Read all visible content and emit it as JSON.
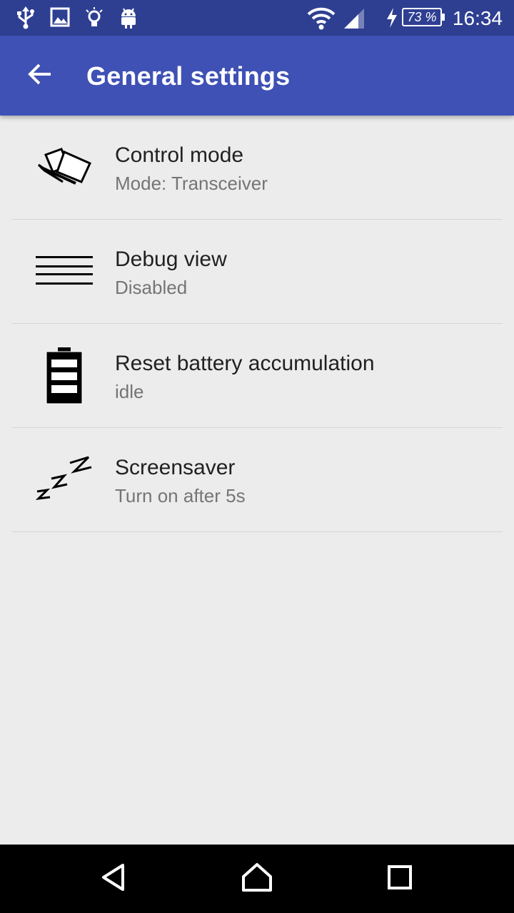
{
  "status_bar": {
    "icons": [
      "usb-icon",
      "image-icon",
      "lightbulb-icon",
      "android-icon",
      "wifi-icon",
      "signal-icon",
      "charging-icon"
    ],
    "battery_text": "73 %",
    "time": "16:34"
  },
  "app_bar": {
    "back_icon": "arrow-left-icon",
    "title": "General settings",
    "background": "#3f51b5",
    "status_background": "#2e3f92"
  },
  "settings": [
    {
      "icon": "control-mode-icon",
      "title": "Control mode",
      "summary": "Mode: Transceiver"
    },
    {
      "icon": "menu-lines-icon",
      "title": "Debug view",
      "summary": "Disabled"
    },
    {
      "icon": "battery-icon",
      "title": "Reset battery accumulation",
      "summary": "idle"
    },
    {
      "icon": "sleep-zzz-icon",
      "title": "Screensaver",
      "summary": "Turn on after 5s"
    }
  ],
  "nav_bar": {
    "buttons": [
      "back-triangle-icon",
      "home-icon",
      "recents-icon"
    ]
  }
}
